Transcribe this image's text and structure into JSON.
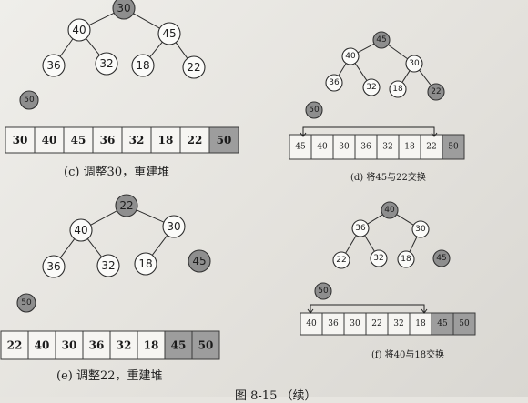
{
  "panel_c": {
    "caption": "(c) 调整30，重建堆",
    "tree": [
      "30",
      "40",
      "45",
      "36",
      "32",
      "18",
      "22"
    ],
    "removed": "50",
    "array": [
      "30",
      "40",
      "45",
      "36",
      "32",
      "18",
      "22",
      "50"
    ],
    "sorted_count": 1
  },
  "panel_d": {
    "caption": "(d) 将45与22交换",
    "tree": [
      "45",
      "40",
      "30",
      "36",
      "32",
      "18",
      "22"
    ],
    "removed": "50",
    "array": [
      "45",
      "40",
      "30",
      "36",
      "32",
      "18",
      "22",
      "50"
    ],
    "sorted_count": 1
  },
  "panel_e": {
    "caption": "(e) 调整22，重建堆",
    "tree": [
      "22",
      "40",
      "30",
      "36",
      "32",
      "18"
    ],
    "loose": "45",
    "removed": "50",
    "array": [
      "22",
      "40",
      "30",
      "36",
      "32",
      "18",
      "45",
      "50"
    ],
    "sorted_count": 2
  },
  "panel_f": {
    "caption": "(f) 将40与18交换",
    "tree": [
      "40",
      "36",
      "30",
      "22",
      "32",
      "18"
    ],
    "loose": "45",
    "removed": "50",
    "array": [
      "40",
      "36",
      "30",
      "22",
      "32",
      "18",
      "45",
      "50"
    ],
    "sorted_count": 2
  },
  "figure_caption": "图 8-15 （续）"
}
